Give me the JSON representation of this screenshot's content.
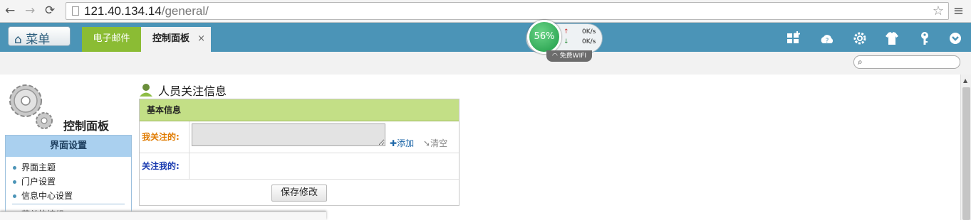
{
  "browser": {
    "url_host": "121.40.134.14",
    "url_path": "/general/"
  },
  "topbar": {
    "menu_label": "菜单",
    "tabs": [
      {
        "label": "电子邮件"
      },
      {
        "label": "控制面板",
        "close": "×"
      }
    ],
    "network": {
      "percent": "56%",
      "up_speed": "0K/s",
      "down_speed": "0K/s",
      "wifi_label": "免费WIFI"
    },
    "icons": [
      "grid-add-icon",
      "cloud-help-icon",
      "gear-icon",
      "shirt-theme-icon",
      "key-icon",
      "chevron-down-circle-icon"
    ]
  },
  "sidebar": {
    "panel_title": "控制面板",
    "section_title": "界面设置",
    "items": [
      "界面主题",
      "门户设置",
      "信息中心设置"
    ],
    "partial_item": "菜单快捷组"
  },
  "main": {
    "title": "人员关注信息",
    "table_header": "基本信息",
    "row1_label": "我关注的:",
    "row2_label": "关注我的:",
    "add_label": "添加",
    "clear_label": "清空",
    "save_label": "保存修改"
  },
  "colors": {
    "topbar": "#4b94b7",
    "tab_active": "#8bbc34",
    "table_header": "#c3df86",
    "sidebar_header": "#aad0ef"
  }
}
